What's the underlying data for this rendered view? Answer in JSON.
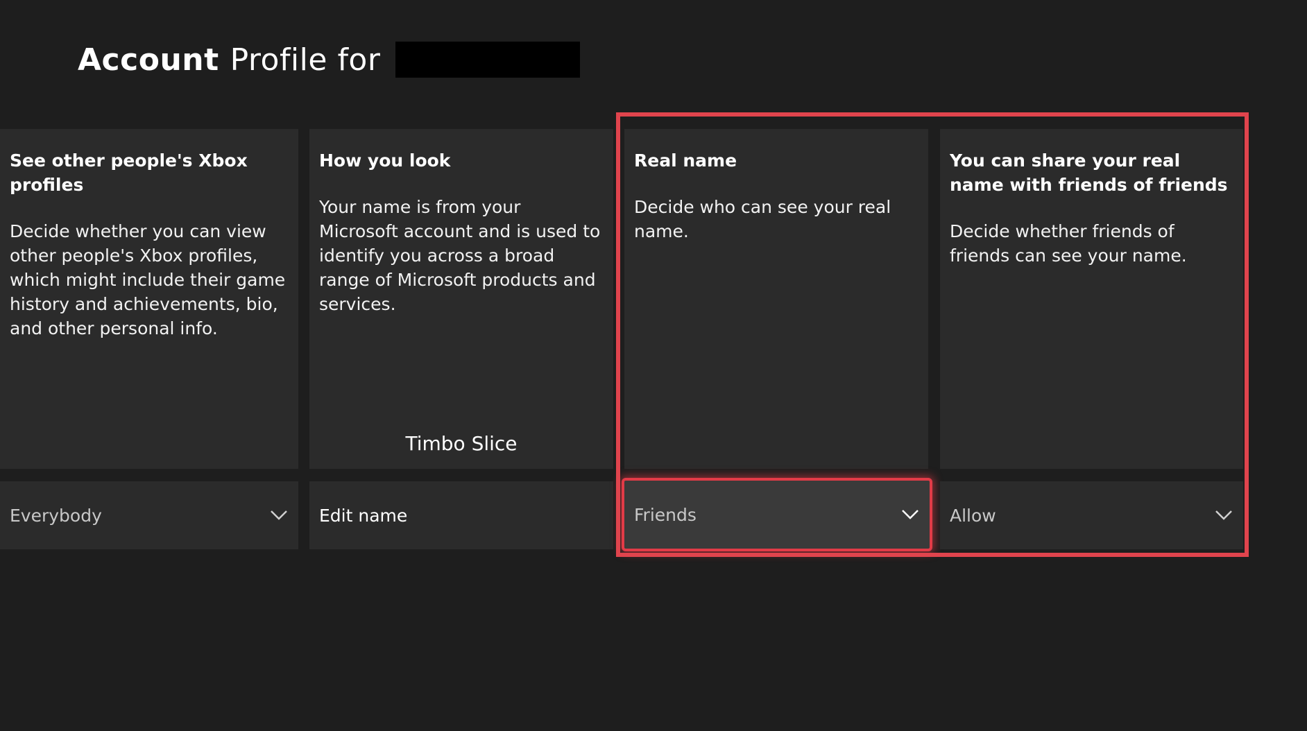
{
  "header": {
    "title_strong": "Account",
    "title_rest": "Profile for"
  },
  "cards": [
    {
      "title": "See other people's Xbox profiles",
      "description": "Decide whether you can view other people's Xbox profiles, which might include their game history and achievements, bio, and other personal info.",
      "control_value": "Everybody"
    },
    {
      "title": "How you look",
      "description": "Your name is from your Microsoft account and is used to identify you across a broad range of Microsoft products and services.",
      "value": "Timbo Slice",
      "control_value": "Edit name"
    },
    {
      "title": "Real name",
      "description": "Decide who can see your real name.",
      "control_value": "Friends"
    },
    {
      "title": "You can share your real name with friends of friends",
      "description": "Decide whether friends of friends can see your name.",
      "control_value": "Allow"
    }
  ],
  "icons": {
    "dropdown": "chevron-down-icon"
  },
  "colors": {
    "background": "#1e1e1e",
    "card": "#2b2b2b",
    "focus": "#e23b47",
    "highlight": "#e0444d"
  }
}
